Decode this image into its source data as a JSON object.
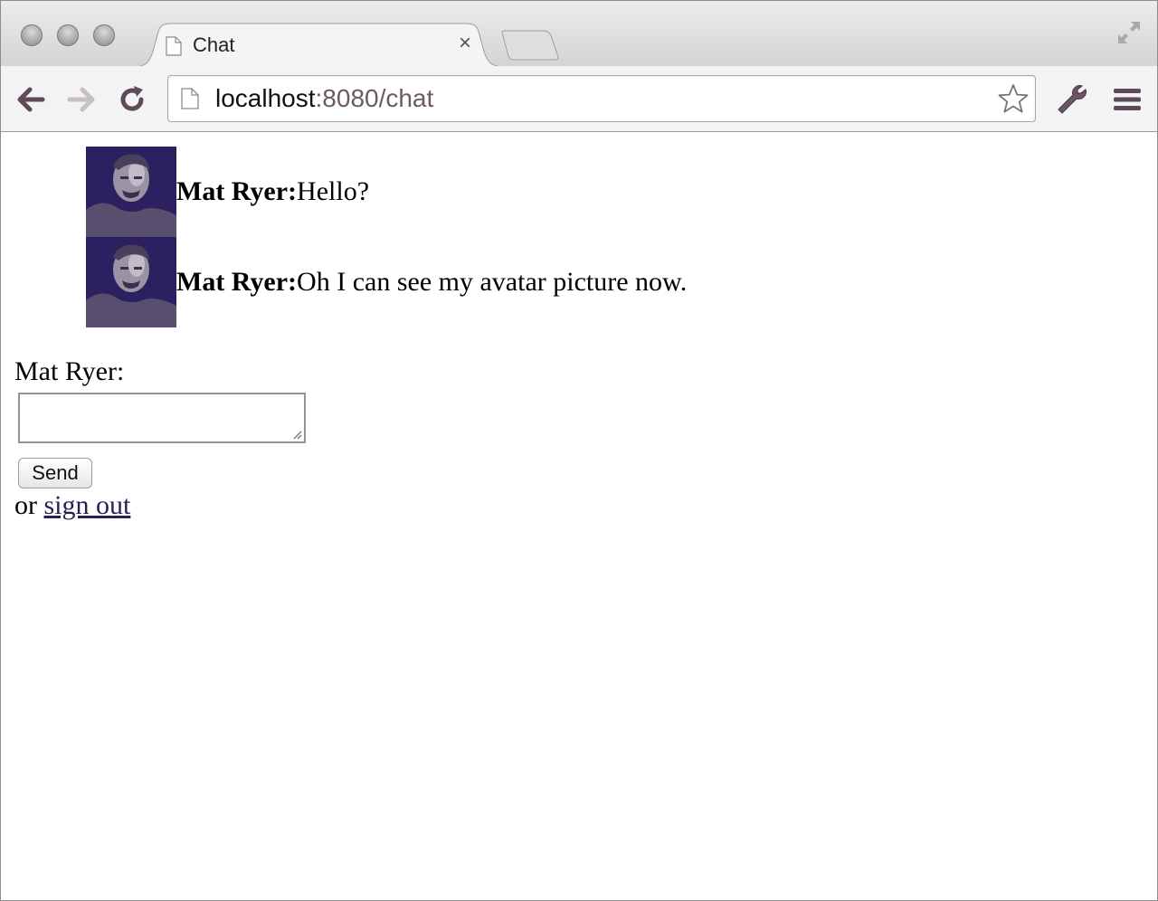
{
  "browser": {
    "tab_title": "Chat",
    "tab_close": "×",
    "url_host": "localhost",
    "url_rest": ":8080/chat"
  },
  "chat": {
    "messages": [
      {
        "author": "Mat Ryer:",
        "text": " Hello?"
      },
      {
        "author": "Mat Ryer:",
        "text": " Oh I can see my avatar picture now."
      }
    ],
    "user_label": "Mat Ryer:",
    "input_value": "",
    "send_label": "Send",
    "signout_prefix": "or ",
    "signout_link": "sign out"
  },
  "icons": {
    "back": "back-arrow-icon",
    "forward": "forward-arrow-icon",
    "reload": "reload-icon",
    "page": "page-document-icon",
    "star": "bookmark-star-icon",
    "wrench": "wrench-icon",
    "menu": "menu-icon",
    "fullscreen": "fullscreen-icon"
  },
  "colors": {
    "link": "#2a1f55",
    "url_path": "#6b5a66",
    "avatar_tint": "#2c2160"
  }
}
